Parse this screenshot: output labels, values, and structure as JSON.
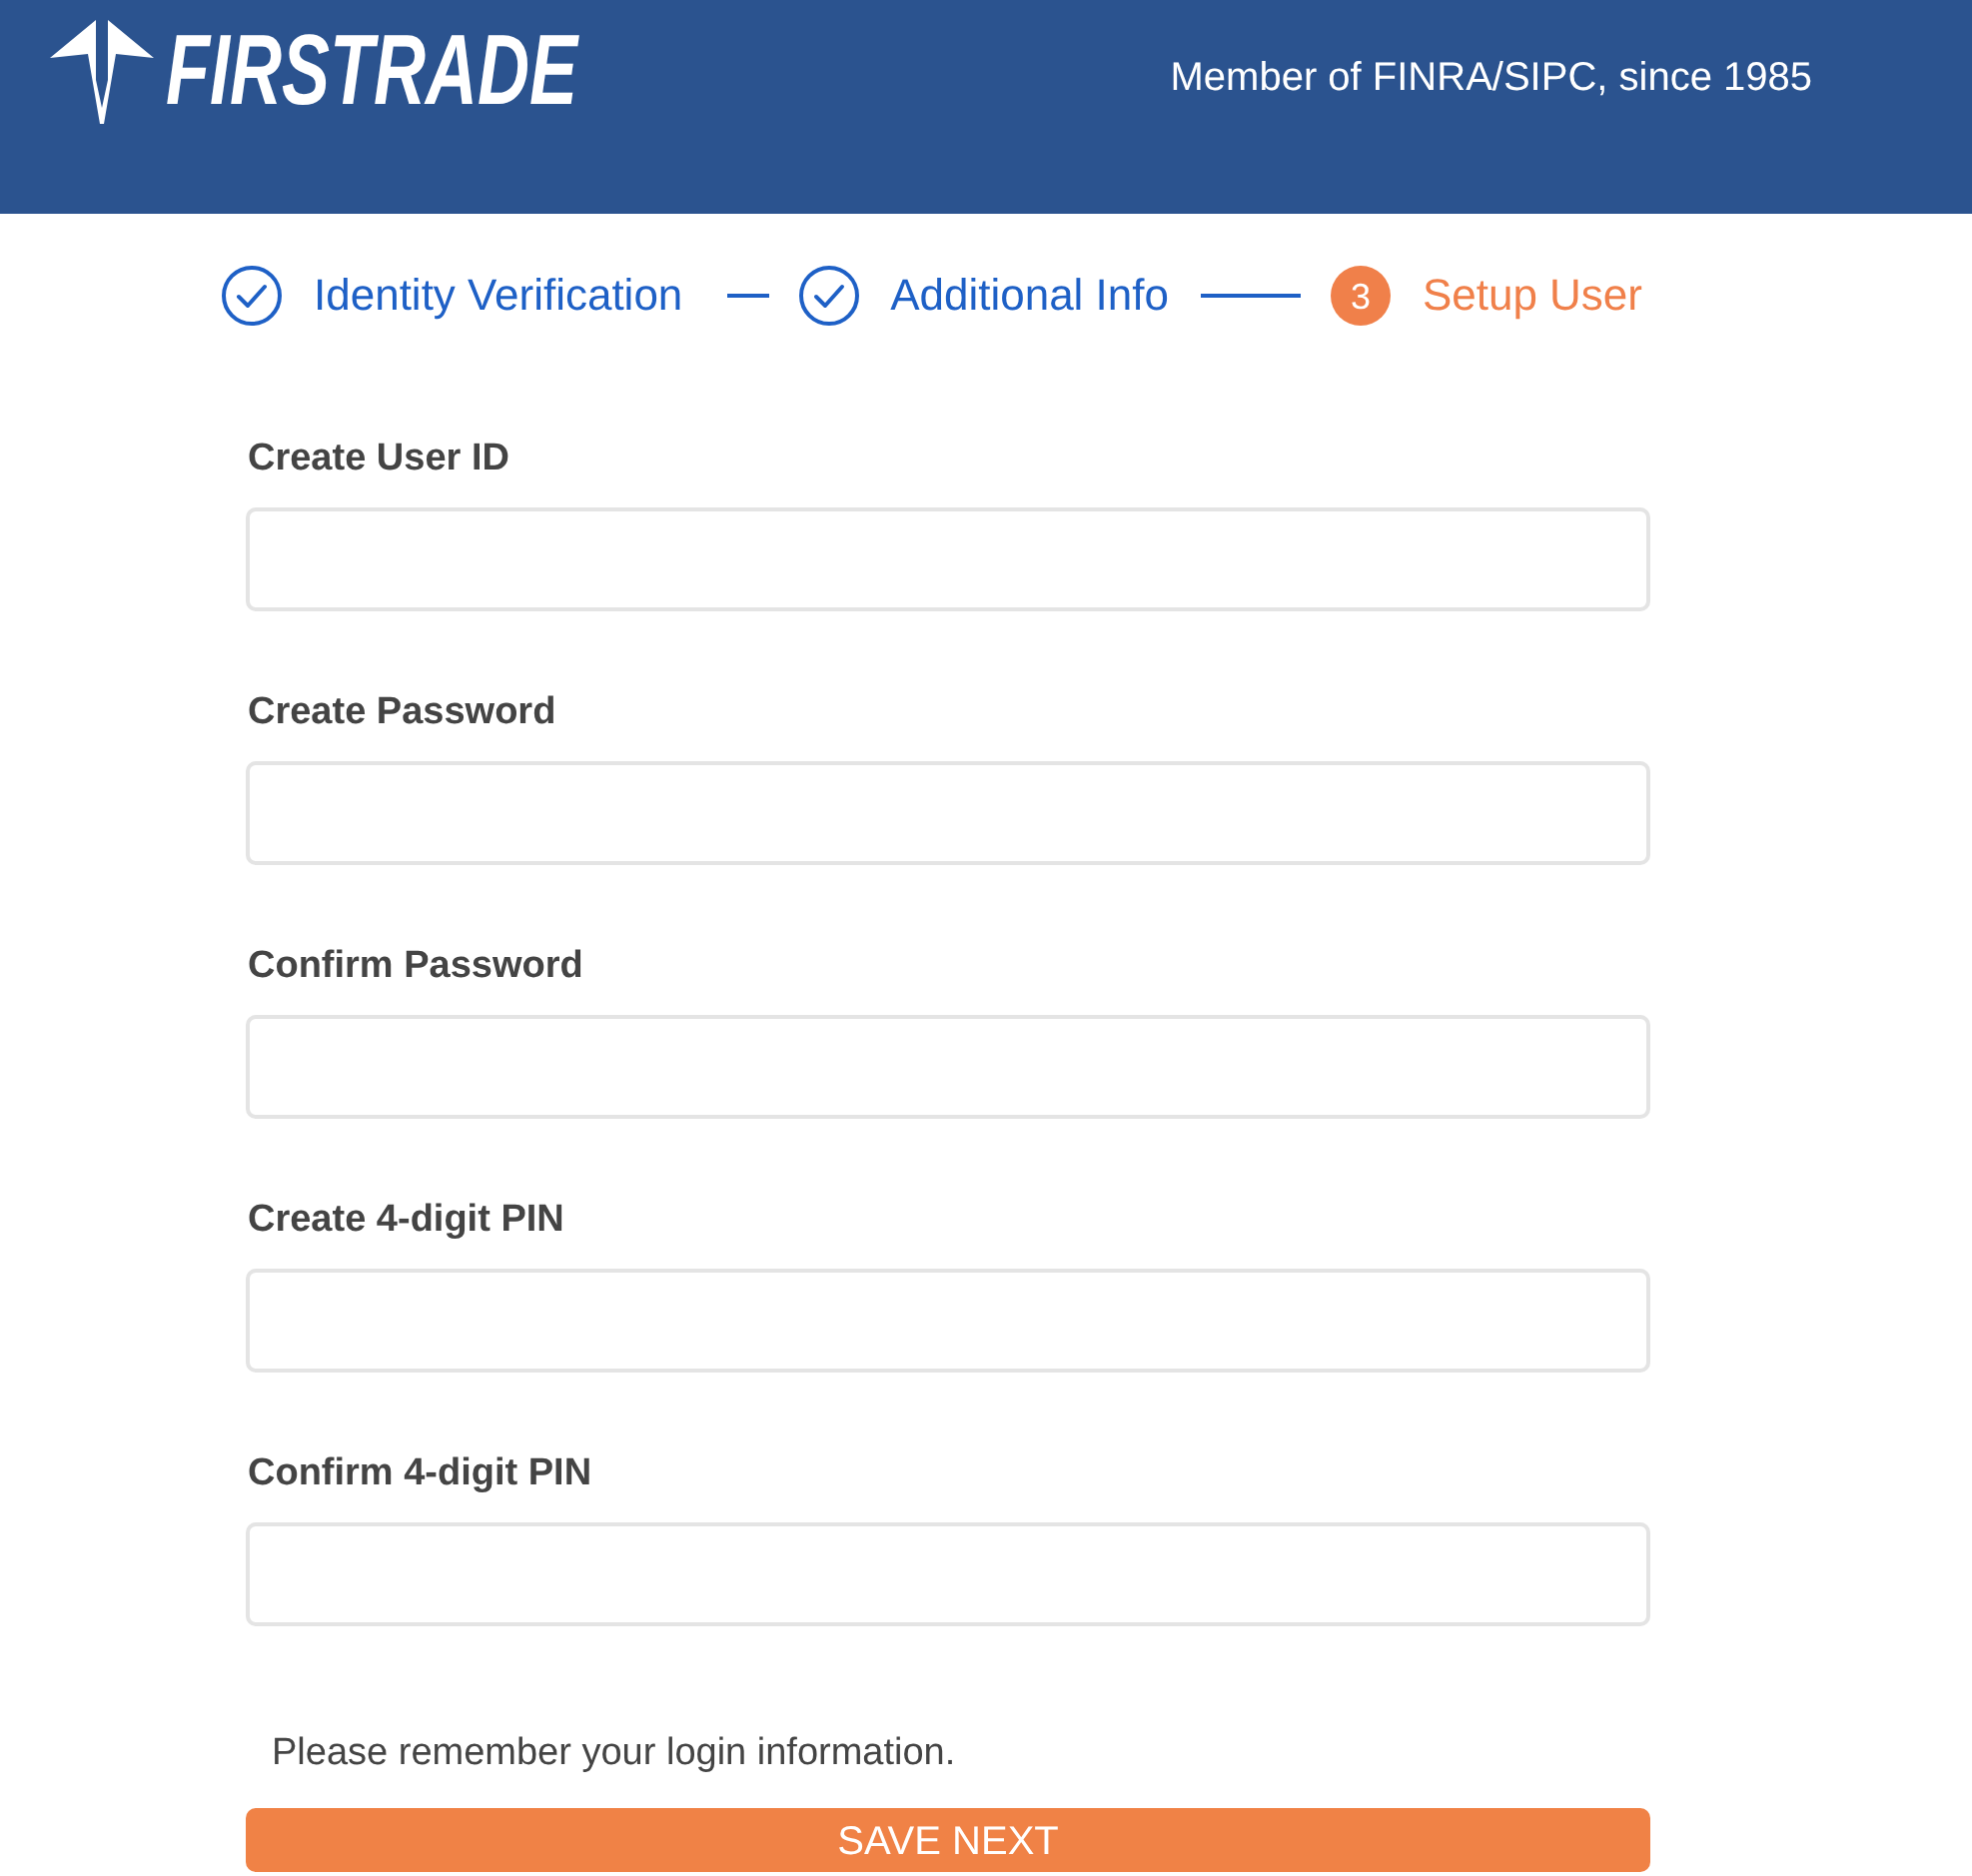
{
  "header": {
    "logo_text": "FIRSTRADE",
    "tagline": "Member of FINRA/SIPC, since 1985"
  },
  "steps": [
    {
      "label": "Identity Verification",
      "completed": true
    },
    {
      "label": "Additional Info",
      "completed": true
    },
    {
      "label": "Setup User",
      "completed": false,
      "number": "3"
    }
  ],
  "fields": [
    {
      "label": "Create User ID"
    },
    {
      "label": "Create Password"
    },
    {
      "label": "Confirm Password"
    },
    {
      "label": "Create 4-digit PIN"
    },
    {
      "label": "Confirm 4-digit PIN"
    }
  ],
  "note": "Please remember your login information.",
  "submit_button": "SAVE NEXT"
}
